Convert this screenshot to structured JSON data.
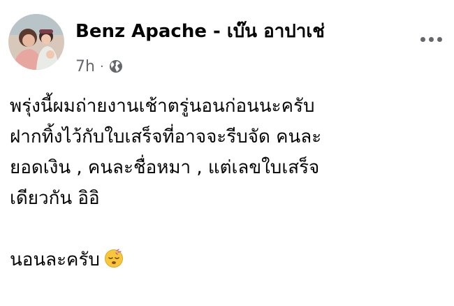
{
  "post": {
    "author": {
      "name": "Benz Apache - เบ๊น อาปาเช่",
      "avatar_icon": "profile-photo"
    },
    "timestamp": "7h",
    "separator": "·",
    "audience_icon": "globe-icon",
    "more_icon": "more-options-icon",
    "body_lines": [
      "พรุ่งนี้ผมถ่ายงานเช้าตรู่นอนก่อนนะครับ",
      "ฝากทิ้งไว้กับใบเสร็จที่อาจจะรีบจัด คนละ",
      "ยอดเงิน , คนละชื่อหมา , แต่เลขใบเสร็จ",
      "เดียวกัน อิอิ"
    ],
    "closing_line": "นอนละครับ",
    "closing_emoji": "sleepy-face-emoji"
  },
  "colors": {
    "text_primary": "#050505",
    "text_secondary": "#65676b",
    "background": "#ffffff"
  }
}
